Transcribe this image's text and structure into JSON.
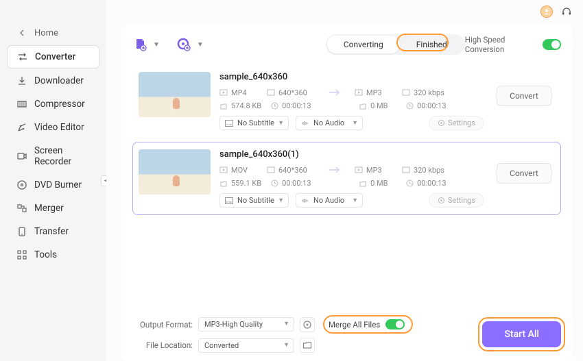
{
  "sidebar": {
    "home_label": "Home",
    "items": [
      {
        "label": "Converter"
      },
      {
        "label": "Downloader"
      },
      {
        "label": "Compressor"
      },
      {
        "label": "Video Editor"
      },
      {
        "label": "Screen Recorder"
      },
      {
        "label": "DVD Burner"
      },
      {
        "label": "Merger"
      },
      {
        "label": "Transfer"
      },
      {
        "label": "Tools"
      }
    ]
  },
  "header": {
    "tab_converting": "Converting",
    "tab_finished": "Finished",
    "high_speed_label": "High Speed Conversion"
  },
  "files": [
    {
      "name": "sample_640x360",
      "src_fmt": "MP4",
      "resolution": "640*360",
      "size": "574.8 KB",
      "duration": "00:00:13",
      "dst_fmt": "MP3",
      "dst_size": "0 MB",
      "bitrate": "320 kbps",
      "dst_duration": "00:00:13",
      "subtitle": "No Subtitle",
      "audio": "No Audio",
      "settings_label": "Settings",
      "convert_label": "Convert"
    },
    {
      "name": "sample_640x360(1)",
      "src_fmt": "MOV",
      "resolution": "640*360",
      "size": "559.1 KB",
      "duration": "00:00:13",
      "dst_fmt": "MP3",
      "dst_size": "0 MB",
      "bitrate": "320 kbps",
      "dst_duration": "00:00:13",
      "subtitle": "No Subtitle",
      "audio": "No Audio",
      "settings_label": "Settings",
      "convert_label": "Convert"
    }
  ],
  "footer": {
    "output_format_label": "Output Format:",
    "output_format_value": "MP3-High Quality",
    "file_location_label": "File Location:",
    "file_location_value": "Converted",
    "merge_label": "Merge All Files",
    "start_all_label": "Start All"
  }
}
